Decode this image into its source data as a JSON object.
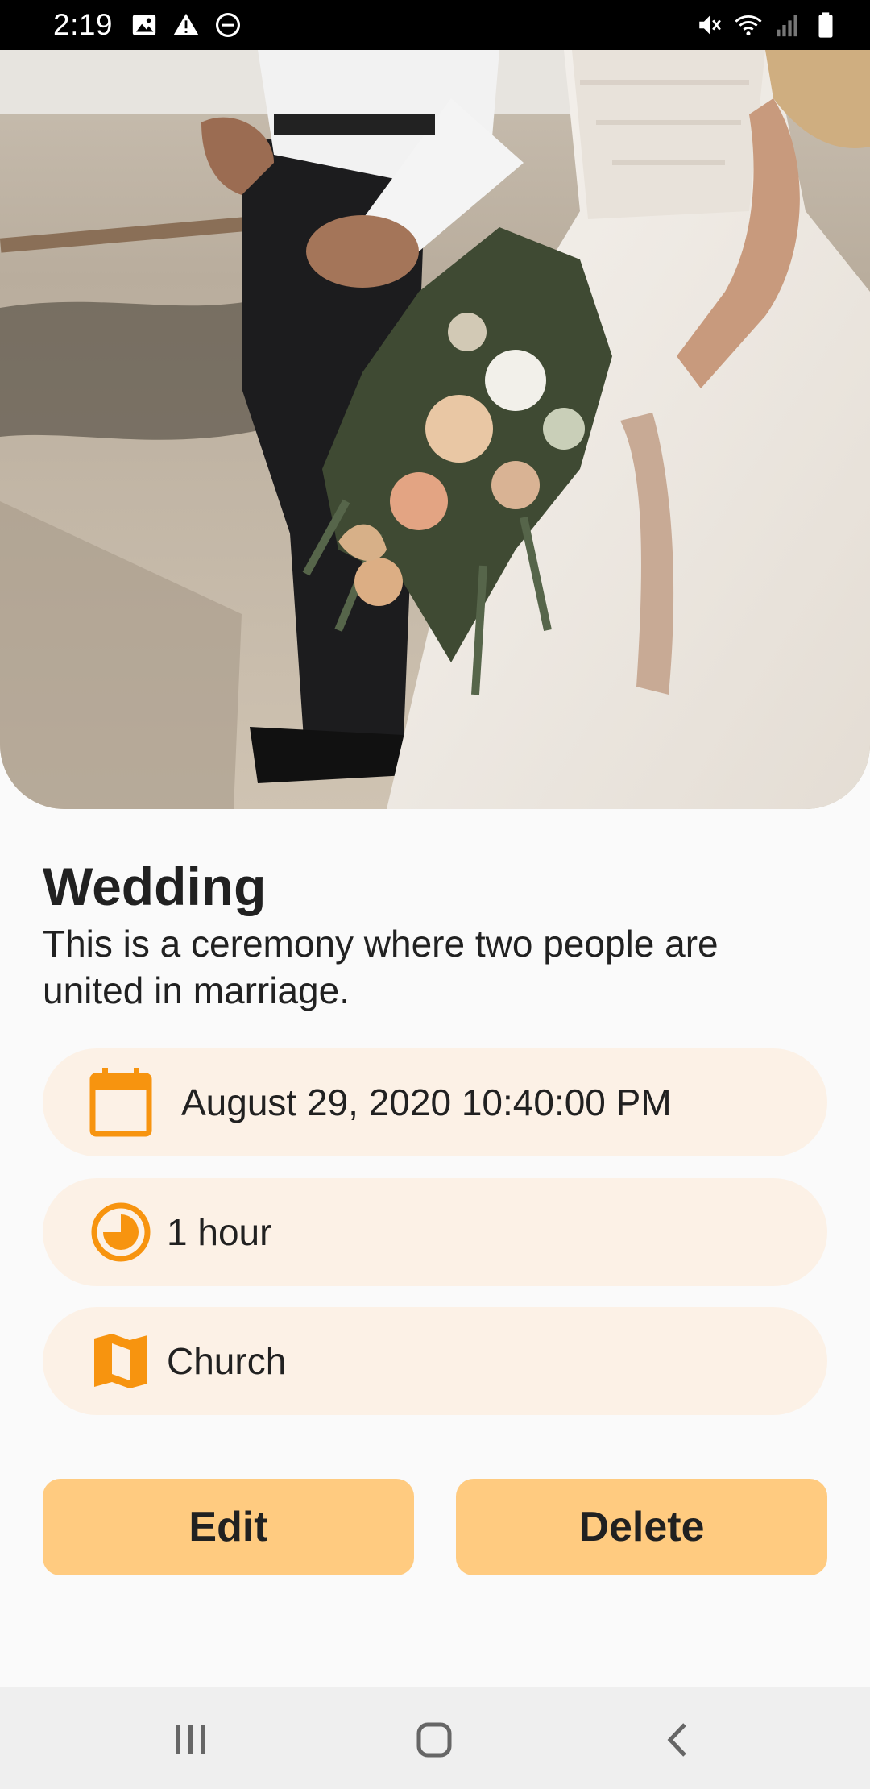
{
  "status_bar": {
    "time": "2:19",
    "left_icons": [
      "image-icon",
      "warning-icon",
      "do-not-disturb-icon"
    ],
    "right_icons": [
      "mute-icon",
      "wifi-icon",
      "signal-icon",
      "battery-icon"
    ]
  },
  "event": {
    "title": "Wedding",
    "description": "This is a ceremony where two people are united in marriage.",
    "date": "August 29, 2020 10:40:00 PM",
    "duration": "1 hour",
    "location": "Church"
  },
  "actions": {
    "edit_label": "Edit",
    "delete_label": "Delete"
  },
  "nav_bar": {
    "icons": [
      "recents-icon",
      "home-icon",
      "back-icon"
    ]
  },
  "colors": {
    "accent": "#f7940f",
    "pill_background": "#fcf1e6",
    "button_background": "#ffcb80",
    "text": "#212121"
  }
}
